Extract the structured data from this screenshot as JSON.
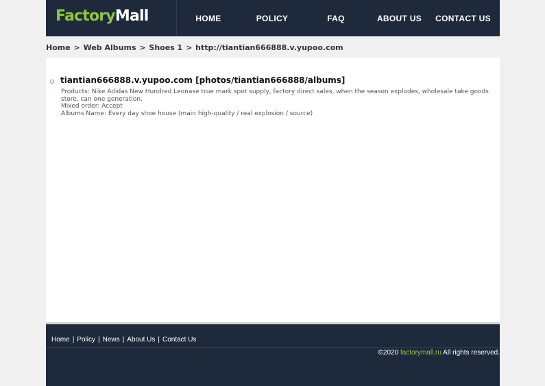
{
  "header": {
    "logo_part1": "Factory",
    "logo_part2": "Mall",
    "nav": [
      "HOME",
      "POLICY",
      "FAQ",
      "ABOUT US",
      "CONTACT US"
    ]
  },
  "breadcrumb": [
    "Home",
    "Web Albums",
    "Shoes 1",
    "http://tiantian666888.v.yupoo.com"
  ],
  "breadcrumb_separator": ">",
  "item": {
    "title": "tiantian666888.v.yupoo.com [photos/tiantian666888/albums]",
    "lines": [
      "Products: Nike Adidas New Hundred Leonase true mark spot supply, factory direct sales, when the season explodes, wholesale take goods store, can one generation.",
      "Mixed order: Accept",
      "Albums Name: Every day shoe house (main high-quality / real explosion / source)"
    ]
  },
  "footer": {
    "links": [
      "Home",
      "Policy",
      "News",
      "About Us",
      "Contact Us"
    ],
    "link_separator": "|",
    "copyright_prefix": "©2020 ",
    "copyright_site": "factorymall.ru",
    "copyright_suffix": " All rights reserved."
  },
  "colors": {
    "header_bg": "#1e2a3b",
    "logo_accent": "#8dc63f",
    "bullet": "#d36aa8"
  }
}
